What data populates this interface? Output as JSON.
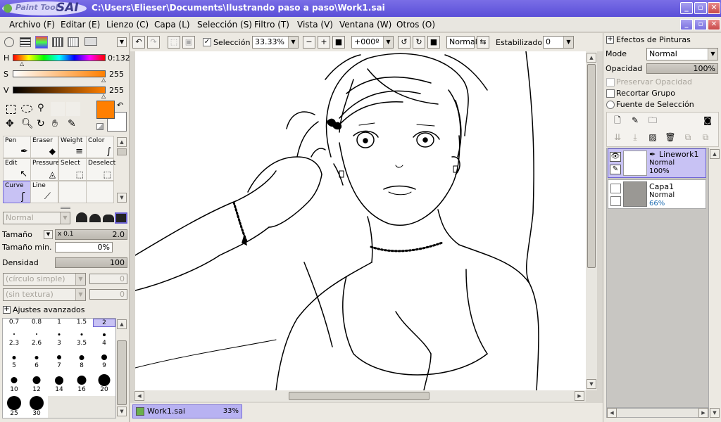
{
  "titlebar": {
    "logo_small": "Paint Tool",
    "logo_big": "SAI",
    "path": "C:\\Users\\Elieser\\Documents\\Ilustrando paso a paso\\Work1.sai"
  },
  "menu": [
    "Archivo (F)",
    "Editar (E)",
    "Lienzo (C)",
    "Capa (L)",
    "Selección (S)",
    "Filtro (T)",
    "Vista (V)",
    "Ventana (W)",
    "Otros (O)"
  ],
  "toolbar": {
    "selection_label": "Selección",
    "zoom": "33.33%",
    "rotation": "+000º",
    "blend": "Normal",
    "stabilizer_label": "Estabilizador",
    "stabilizer_value": "0"
  },
  "color": {
    "h_label": "H",
    "h_value": "0:132",
    "s_label": "S",
    "s_value": "255",
    "v_label": "V",
    "v_value": "255",
    "primary": "#ff7f00"
  },
  "tools": [
    {
      "name": "Pen",
      "icon": "pen-icon"
    },
    {
      "name": "Eraser",
      "icon": "eraser-icon"
    },
    {
      "name": "Weight",
      "icon": "weight-icon"
    },
    {
      "name": "Color",
      "icon": "color-icon"
    },
    {
      "name": "Edit",
      "icon": "edit-icon"
    },
    {
      "name": "Pressure",
      "icon": "pressure-icon"
    },
    {
      "name": "Select",
      "icon": "select-icon"
    },
    {
      "name": "Deselect",
      "icon": "deselect-icon"
    },
    {
      "name": "Curve",
      "icon": "curve-icon"
    },
    {
      "name": "Line",
      "icon": "line-icon"
    }
  ],
  "brush": {
    "mode": "Normal",
    "size_label": "Tamaño",
    "size_mult": "x 0.1",
    "size_value": "2.0",
    "min_size_label": "Tamaño min.",
    "min_size_value": "0%",
    "density_label": "Densidad",
    "density_value": "100",
    "shape": "(círculo simple)",
    "shape_value": "0",
    "texture": "(sin textura)",
    "texture_value": "0",
    "advanced": "Ajustes avanzados",
    "sizes": [
      "0.7",
      "0.8",
      "1",
      "1.5",
      "2",
      "2.3",
      "2.6",
      "3",
      "3.5",
      "4",
      "5",
      "6",
      "7",
      "8",
      "9",
      "10",
      "12",
      "14",
      "16",
      "20",
      "25",
      "30"
    ]
  },
  "doc_tab": {
    "name": "Work1.sai",
    "zoom": "33%"
  },
  "layers_panel": {
    "effects": "Efectos de Pinturas",
    "mode_label": "Mode",
    "mode_value": "Normal",
    "opacity_label": "Opacidad",
    "opacity_value": "100%",
    "preserve": "Preservar Opacidad",
    "clip": "Recortar Grupo",
    "source": "Fuente de Selección",
    "layers": [
      {
        "name": "Linework1",
        "mode": "Normal",
        "opacity": "100%"
      },
      {
        "name": "Capa1",
        "mode": "Normal",
        "opacity": "66%"
      }
    ]
  }
}
